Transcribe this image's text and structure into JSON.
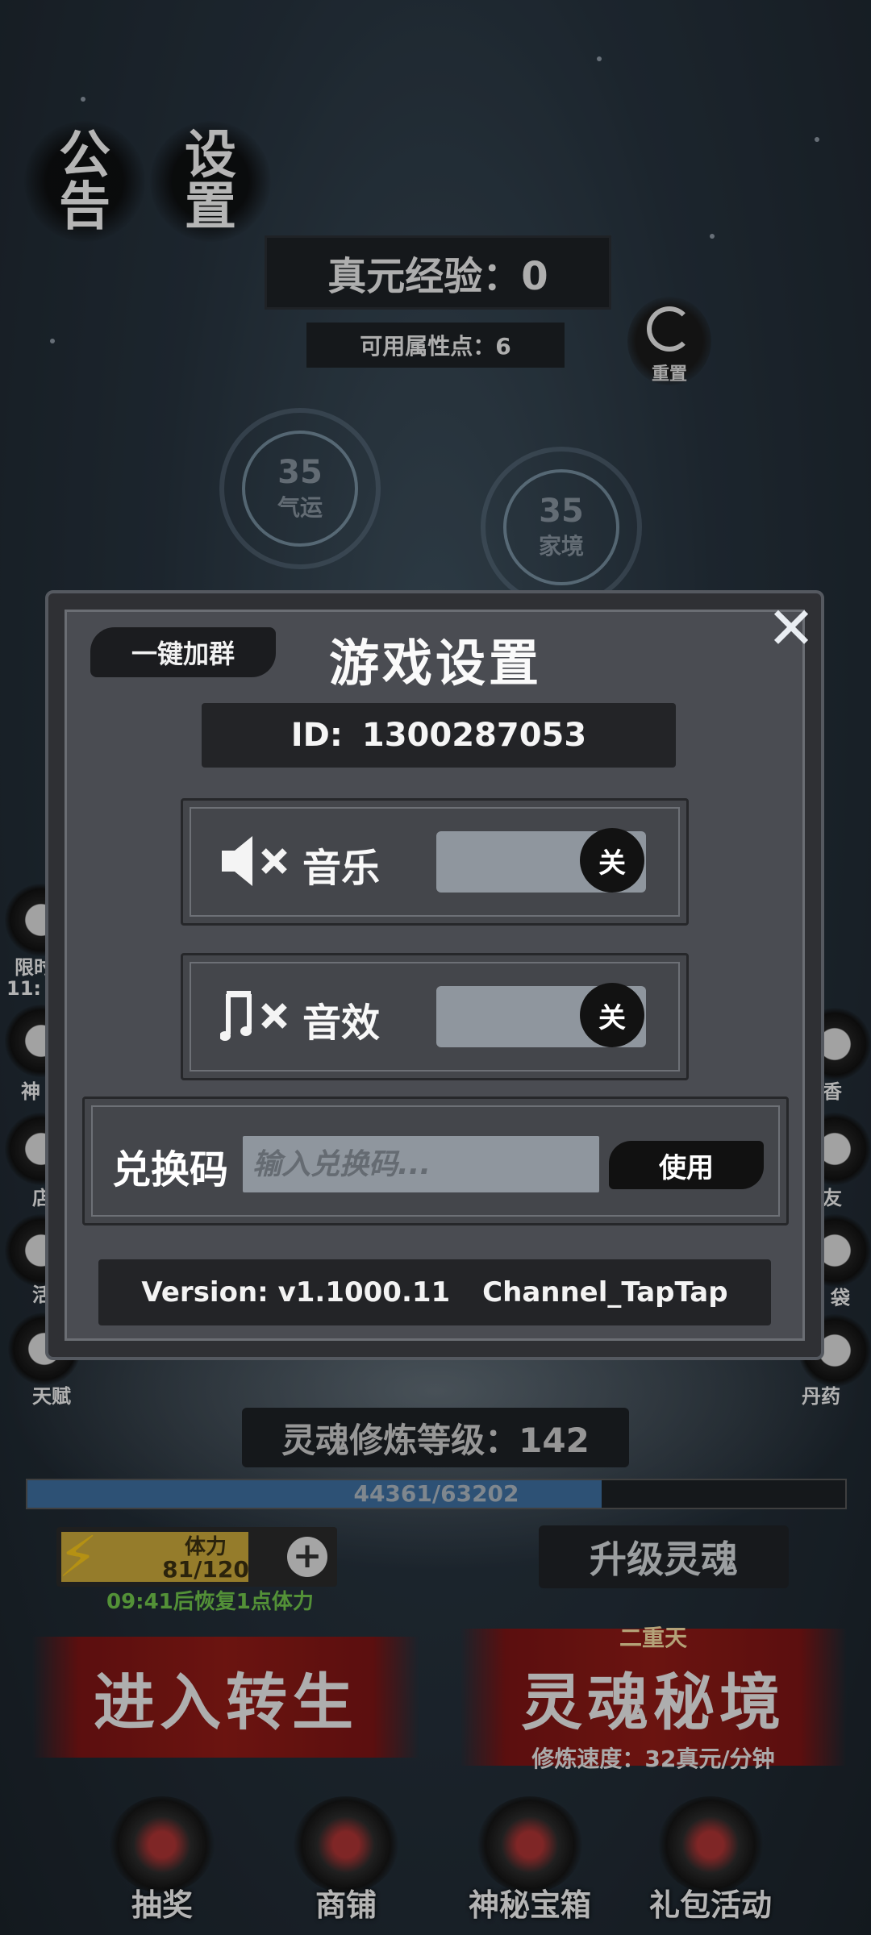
{
  "header": {
    "notice_label": "公告",
    "settings_label": "设置",
    "true_exp": "真元经验：0",
    "attr_points": "可用属性点：6",
    "reset_label": "重置"
  },
  "stats": [
    {
      "value": "35",
      "name": "气运"
    },
    {
      "value": "35",
      "name": "家境"
    }
  ],
  "side_icons": {
    "left": [
      "限时",
      "11:",
      "神",
      "店",
      "活",
      "天赋"
    ],
    "right": [
      "香",
      "友",
      "袋",
      "丹药"
    ]
  },
  "modal": {
    "title": "游戏设置",
    "join_group_label": "一键加群",
    "id_label": "ID:",
    "id_value": "1300287053",
    "music": {
      "label": "音乐",
      "state": "关",
      "icon": "music-muted-icon"
    },
    "sfx": {
      "label": "音效",
      "state": "关",
      "icon": "sfx-muted-icon"
    },
    "redeem": {
      "label": "兑换码",
      "placeholder": "输入兑换码...",
      "button": "使用"
    },
    "version": "Version: v1.1000.11",
    "channel": "Channel_TapTap",
    "close_icon": "close-icon"
  },
  "hud": {
    "soul_level": "灵魂修炼等级：142",
    "xp_text": "44361/63202",
    "xp_fraction": 0.702,
    "stamina_label": "体力",
    "stamina_value": "81/120",
    "recover_text": "09:41后恢复1点体力",
    "upgrade_soul": "升级灵魂",
    "rebirth": "进入转生",
    "realm_tier": "二重天",
    "soul_realm": "灵魂秘境",
    "cultivation_speed": "修炼速度：32真元/分钟"
  },
  "nav": [
    {
      "label": "抽奖",
      "icon": "lottery-icon"
    },
    {
      "label": "商铺",
      "icon": "shop-icon"
    },
    {
      "label": "神秘宝箱",
      "icon": "mystery-chest-icon"
    },
    {
      "label": "礼包活动",
      "icon": "gift-pack-icon"
    }
  ],
  "colors": {
    "xp_fill": "#3d6c9c",
    "stamina_fill": "#c7a63a",
    "recover_text": "#6fc24a",
    "big_button_red": "#8f1b16"
  }
}
